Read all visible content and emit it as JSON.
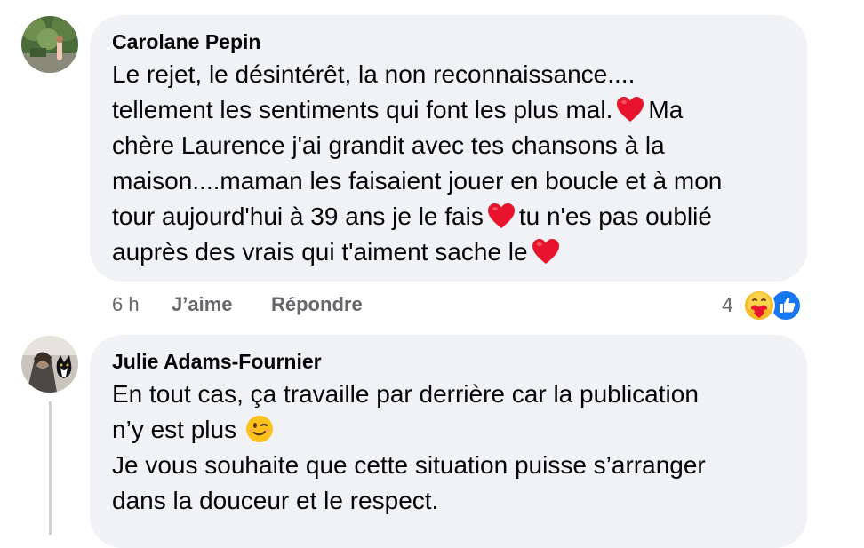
{
  "comments": [
    {
      "author": "Carolane Pepin",
      "lines": [
        "Le rejet, le désintérêt, la non reconnaissance....",
        "tellement les sentiments qui font les plus mal.",
        "Ma",
        "chère Laurence j'ai grandit avec tes chansons à la",
        "maison....maman les faisaient jouer en boucle et à mon",
        "tour aujourd'hui à 39 ans je le fais",
        "tu n'es pas oublié",
        "auprès des vrais qui t'aiment sache le"
      ],
      "time": "6 h",
      "like_label": "J’aime",
      "reply_label": "Répondre",
      "reaction_count": "4"
    },
    {
      "author": "Julie Adams-Fournier",
      "lines": [
        "En tout cas, ça travaille par derrière car la publication",
        "n’y est plus",
        "Je vous souhaite que cette situation puisse s’arranger",
        "dans la douceur et le respect."
      ]
    }
  ],
  "icons": {
    "heart": "red-heart-emoji",
    "wink": "winking-face-emoji",
    "care": "care-reaction",
    "like": "like-reaction"
  },
  "colors": {
    "bubble": "#f0f2f5",
    "meta_text": "#65676b",
    "like_blue": "#1877f2",
    "heart_red": "#e8132c"
  }
}
